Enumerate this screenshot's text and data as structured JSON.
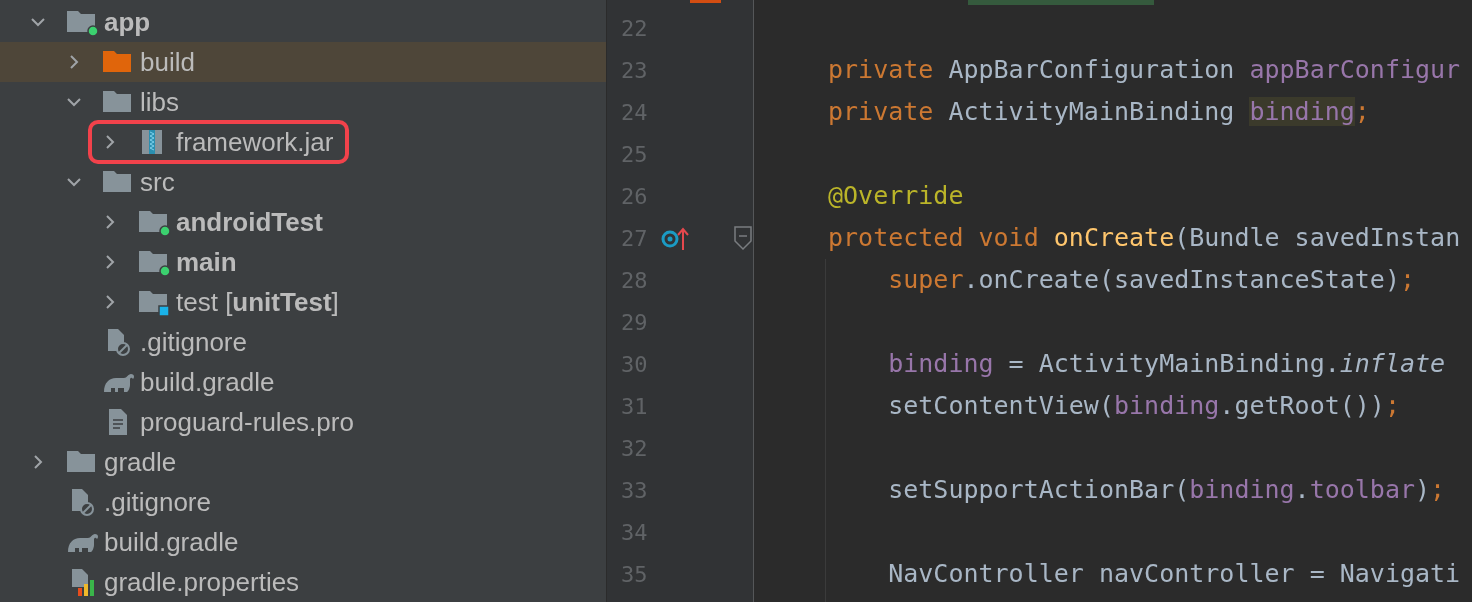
{
  "project_tree": [
    {
      "label": "app",
      "bold": true,
      "kind": "module-folder",
      "expanded": true,
      "selected": false,
      "children": [
        {
          "label": "build",
          "kind": "excluded-folder",
          "expanded": false,
          "selected": true
        },
        {
          "label": "libs",
          "kind": "folder",
          "expanded": true,
          "selected": false,
          "children": [
            {
              "label": "framework.jar",
              "kind": "jar",
              "expanded": false,
              "selected": false,
              "boxed": true
            }
          ]
        },
        {
          "label": "src",
          "kind": "folder",
          "expanded": true,
          "selected": false,
          "children": [
            {
              "label": "androidTest",
              "bold": true,
              "kind": "source-folder",
              "expanded": false,
              "selected": false
            },
            {
              "label": "main",
              "bold": true,
              "kind": "source-folder",
              "expanded": false,
              "selected": false
            },
            {
              "label": "test [**unitTest**]",
              "kind": "test-folder",
              "expanded": false,
              "selected": false
            }
          ]
        },
        {
          "label": ".gitignore",
          "kind": "ignore-file",
          "selected": false
        },
        {
          "label": "build.gradle",
          "kind": "gradle",
          "selected": false
        },
        {
          "label": "proguard-rules.pro",
          "kind": "text-file",
          "selected": false
        }
      ]
    },
    {
      "label": "gradle",
      "kind": "folder",
      "expanded": false,
      "selected": false
    },
    {
      "label": ".gitignore",
      "kind": "ignore-file",
      "selected": false
    },
    {
      "label": "build.gradle",
      "kind": "gradle",
      "selected": false
    },
    {
      "label": "gradle.properties",
      "kind": "properties-file",
      "selected": false
    }
  ],
  "editor": {
    "lines": [
      {
        "number": "22"
      },
      {
        "number": "23",
        "tokens": [
          {
            "kind": "keyword",
            "text": "private"
          },
          {
            "kind": "plain",
            "text": " AppBarConfiguration "
          },
          {
            "kind": "field",
            "text": "appBarConfigur"
          }
        ]
      },
      {
        "number": "24",
        "tokens": [
          {
            "kind": "keyword",
            "text": "private"
          },
          {
            "kind": "plain",
            "text": " ActivityMainBinding "
          },
          {
            "kind": "field",
            "text": "binding",
            "highlight": true
          },
          {
            "kind": "keyword",
            "text": ";"
          }
        ]
      },
      {
        "number": "25"
      },
      {
        "number": "26",
        "tokens": [
          {
            "kind": "annotation",
            "text": "@Override"
          }
        ]
      },
      {
        "number": "27",
        "override": true,
        "fold": true,
        "tokens": [
          {
            "kind": "keyword",
            "text": "protected void "
          },
          {
            "kind": "method",
            "text": "onCreate"
          },
          {
            "kind": "plain",
            "text": "(Bundle savedInstan"
          }
        ],
        "children": [
          {
            "number": "28",
            "tokens": [
              {
                "kind": "keyword",
                "text": "super"
              },
              {
                "kind": "plain",
                "text": ".onCreate(savedInstanceState)"
              },
              {
                "kind": "keyword",
                "text": ";"
              }
            ]
          },
          {
            "number": "29"
          },
          {
            "number": "30",
            "tokens": [
              {
                "kind": "field",
                "text": "binding"
              },
              {
                "kind": "plain",
                "text": " = ActivityMainBinding."
              },
              {
                "kind": "static",
                "text": "inflate"
              }
            ]
          },
          {
            "number": "31",
            "tokens": [
              {
                "kind": "plain",
                "text": "setContentView("
              },
              {
                "kind": "field",
                "text": "binding"
              },
              {
                "kind": "plain",
                "text": ".getRoot())"
              },
              {
                "kind": "keyword",
                "text": ";"
              }
            ]
          },
          {
            "number": "32"
          },
          {
            "number": "33",
            "tokens": [
              {
                "kind": "plain",
                "text": "setSupportActionBar("
              },
              {
                "kind": "field",
                "text": "binding"
              },
              {
                "kind": "plain",
                "text": "."
              },
              {
                "kind": "field",
                "text": "toolbar"
              },
              {
                "kind": "plain",
                "text": ")"
              },
              {
                "kind": "keyword",
                "text": ";"
              }
            ]
          },
          {
            "number": "34"
          },
          {
            "number": "35",
            "tokens": [
              {
                "kind": "plain",
                "text": "NavController navController = Navigati"
              }
            ]
          }
        ]
      }
    ]
  }
}
